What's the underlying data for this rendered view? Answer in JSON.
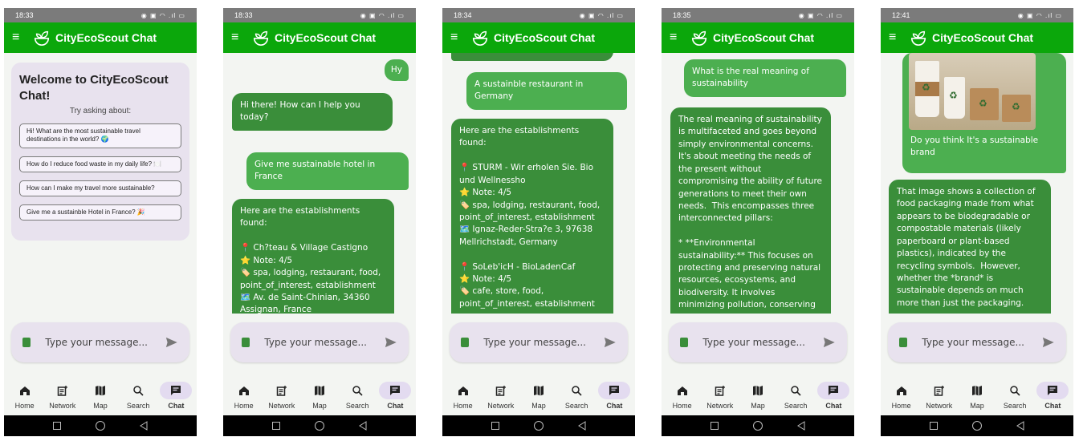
{
  "app": {
    "title": "CityEcoScout Chat",
    "input_placeholder": "Type your message...",
    "nav": [
      "Home",
      "Network",
      "Map",
      "Search",
      "Chat"
    ],
    "active_nav": "Chat",
    "colors": {
      "appbar": "#0ba70b",
      "user_bubble": "#4caf50",
      "bot_bubble": "#3a8e3a",
      "input_bg": "#e8e2ee"
    }
  },
  "screens": [
    {
      "time": "18:33",
      "type": "welcome",
      "welcome_title": "Welcome to CityEcoScout Chat!",
      "welcome_subtitle": "Try asking about:",
      "suggestions": [
        "Hi! What are the most sustainable travel destinations in the world? 🌍",
        "How do I reduce food waste in my daily life? 🍽️",
        "How can I make my travel more sustainable?",
        "Give me a sustainble Hotel in France? 🎉"
      ]
    },
    {
      "time": "18:33",
      "type": "chat",
      "messages": [
        {
          "from": "user",
          "text": "Hy"
        },
        {
          "from": "bot",
          "text": "Hi there! How can I help you today?"
        },
        {
          "from": "user",
          "text": "Give me sustainable hotel in France"
        },
        {
          "from": "bot",
          "text": "Here are the establishments found:\n\n📍 Ch?teau & Village Castigno\n⭐ Note: 4/5\n🏷️ spa, lodging, restaurant, food, point_of_interest, establishment\n🗺️ Av. de Saint-Chinian, 34360 Assignan, France"
        }
      ]
    },
    {
      "time": "18:34",
      "type": "chat",
      "messages": [
        {
          "from": "user",
          "text": "A sustainble restaurant in Germany"
        },
        {
          "from": "bot",
          "text": "Here are the establishments found:\n\n📍 STURM - Wir erholen Sie. Bio und Wellnessho\n⭐ Note: 4/5\n🏷️ spa, lodging, restaurant, food, point_of_interest, establishment\n🗺️ Ignaz-Reder-Stra?e 3, 97638 Mellrichstadt, Germany\n\n📍 SoLeb'icH - BioLadenCaf\n⭐ Note: 4/5\n🏷️ cafe, store, food, point_of_interest, establishment"
        }
      ]
    },
    {
      "time": "18:35",
      "type": "chat",
      "messages": [
        {
          "from": "user",
          "text": "What is the real meaning of sustainability"
        },
        {
          "from": "bot",
          "text": "The real meaning of sustainability is multifaceted and goes beyond simply environmental concerns. It's about meeting the needs of the present without compromising the ability of future generations to meet their own needs.  This encompasses three interconnected pillars:\n\n* **Environmental sustainability:** This focuses on protecting and preserving natural resources, ecosystems, and biodiversity. It involves minimizing pollution, conserving energy and"
        }
      ]
    },
    {
      "time": "12:41",
      "type": "chat",
      "messages": [
        {
          "from": "user",
          "text": "Do you think It's a sustainable brand"
        },
        {
          "from": "bot",
          "text": "That image shows a collection of food packaging made from what appears to be biodegradable or compostable materials (likely paperboard or plant-based plastics), indicated by the recycling symbols.  However, whether the *brand* is sustainable depends on much more than just the packaging."
        }
      ]
    }
  ]
}
